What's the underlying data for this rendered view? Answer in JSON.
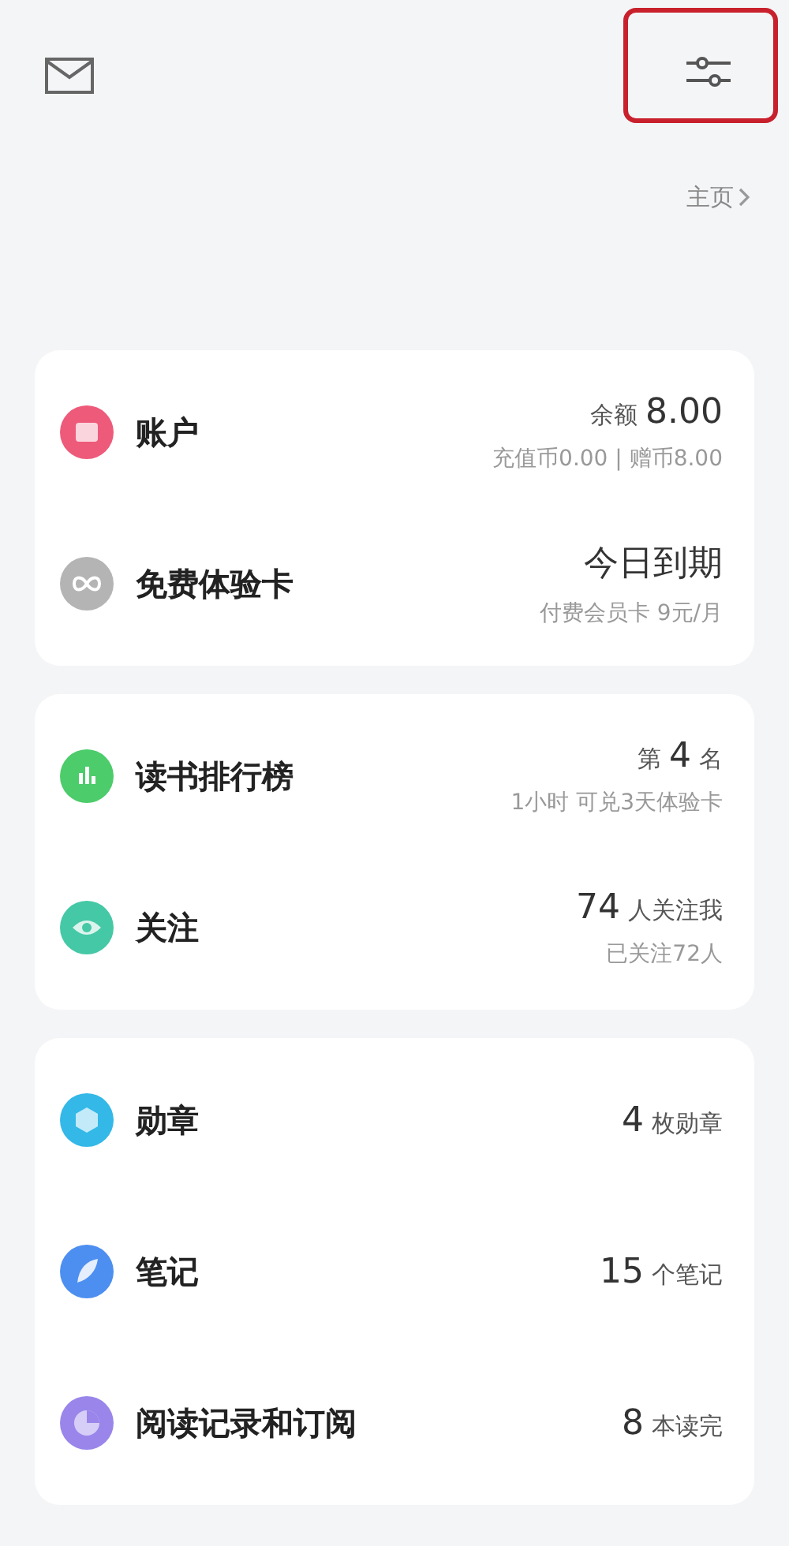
{
  "header": {
    "mail": {
      "kind": "mail"
    },
    "settings": {
      "kind": "settings",
      "highlighted": true
    },
    "home_link": "主页"
  },
  "cards": [
    {
      "rows": [
        {
          "kind": "wallet",
          "color": "#ee5a7a",
          "label": "账户",
          "prefix": "余额",
          "value": "8.00",
          "suffix": "",
          "note": "充值币0.00 | 赠币8.00"
        },
        {
          "kind": "infinity",
          "color": "#b4b4b4",
          "label": "免费体验卡",
          "prefix": "",
          "value": "今日到期",
          "suffix": "",
          "note": "付费会员卡 9元/月"
        }
      ]
    },
    {
      "rows": [
        {
          "kind": "chart",
          "color": "#4ccc6a",
          "label": "读书排行榜",
          "prefix": "第",
          "value": "4",
          "suffix": "名",
          "note": "1小时 可兑3天体验卡"
        },
        {
          "kind": "eye",
          "color": "#45c8a6",
          "label": "关注",
          "prefix": "",
          "value": "74",
          "suffix": "人关注我",
          "note": "已关注72人"
        }
      ]
    },
    {
      "rows": [
        {
          "kind": "badge",
          "color": "#33b8e8",
          "label": "勋章",
          "prefix": "",
          "value": "4",
          "suffix": "枚勋章",
          "note": ""
        },
        {
          "kind": "leaf",
          "color": "#4d8ff0",
          "label": "笔记",
          "prefix": "",
          "value": "15",
          "suffix": "个笔记",
          "note": ""
        },
        {
          "kind": "clock",
          "color": "#9a86ea",
          "label": "阅读记录和订阅",
          "prefix": "",
          "value": "8",
          "suffix": "本读完",
          "note": ""
        }
      ]
    }
  ]
}
